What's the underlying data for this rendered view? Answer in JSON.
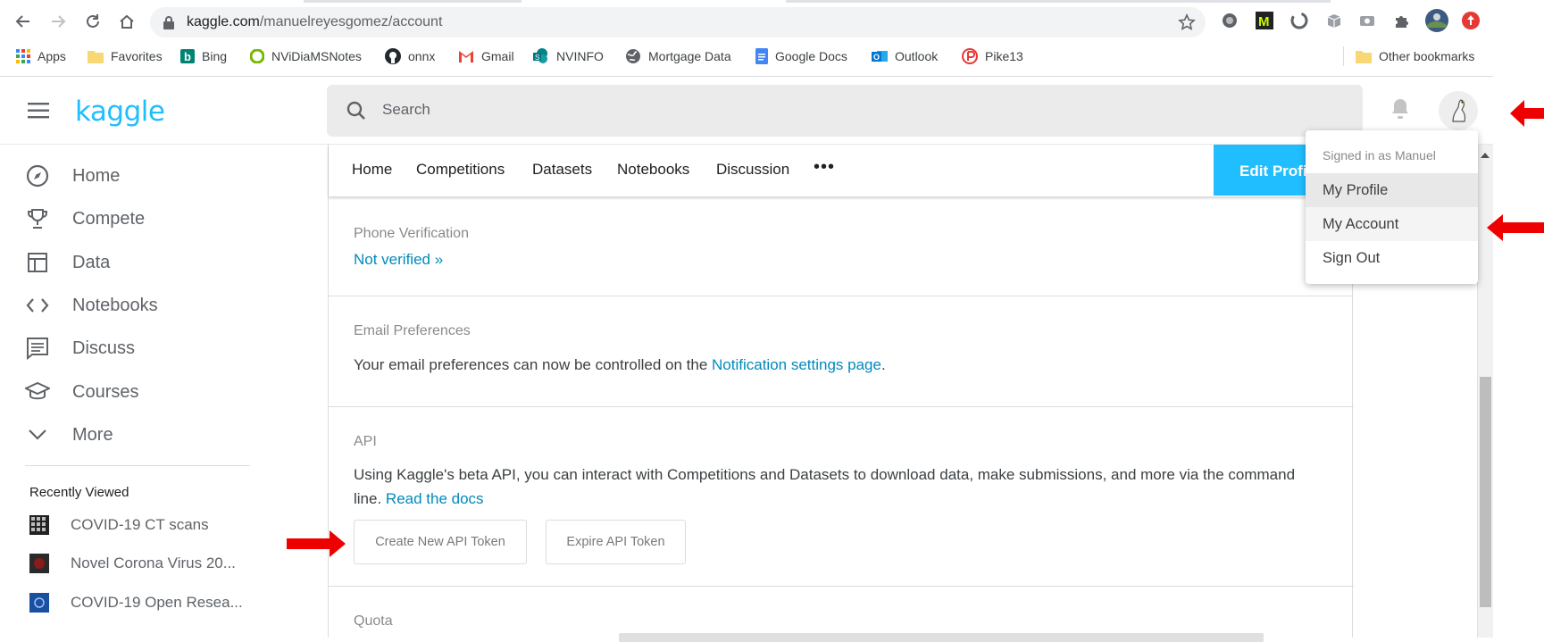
{
  "browser": {
    "url_host": "kaggle.com",
    "url_path": "/manuelreyesgomez/account",
    "nav_icons": [
      "back-icon",
      "forward-icon",
      "reload-icon",
      "home-icon",
      "lock-icon",
      "star-icon"
    ],
    "extensions": [
      "ext-circle-icon",
      "ext-m-icon",
      "ext-spinner-icon",
      "ext-box-icon",
      "ext-camera-icon",
      "puzzle-icon",
      "profile-avatar-icon",
      "ext-red-icon"
    ],
    "bookmarks": [
      {
        "label": "Apps",
        "icon": "apps-grid-icon",
        "color": "#4285f4"
      },
      {
        "label": "Favorites",
        "icon": "folder-icon",
        "color": "#f8d775"
      },
      {
        "label": "Bing",
        "icon": "bing-icon",
        "color": "#008373"
      },
      {
        "label": "NViDiaMSNotes",
        "icon": "nvidia-icon",
        "color": "#76b900"
      },
      {
        "label": "onnx",
        "icon": "github-icon",
        "color": "#24292e"
      },
      {
        "label": "Gmail",
        "icon": "gmail-icon",
        "color": "#ea4335"
      },
      {
        "label": "NVINFO",
        "icon": "sharepoint-icon",
        "color": "#038387"
      },
      {
        "label": "Mortgage Data",
        "icon": "globe-icon",
        "color": "#5f6368"
      },
      {
        "label": "Google Docs",
        "icon": "docs-icon",
        "color": "#4285f4"
      },
      {
        "label": "Outlook",
        "icon": "outlook-icon",
        "color": "#0078d4"
      },
      {
        "label": "Pike13",
        "icon": "pike13-icon",
        "color": "#e53935"
      }
    ],
    "other_bookmarks": "Other bookmarks"
  },
  "header": {
    "logo": "kaggle",
    "search_placeholder": "Search"
  },
  "sidebar": {
    "items": [
      {
        "label": "Home",
        "icon": "compass-icon"
      },
      {
        "label": "Compete",
        "icon": "trophy-icon"
      },
      {
        "label": "Data",
        "icon": "table-icon"
      },
      {
        "label": "Notebooks",
        "icon": "code-icon"
      },
      {
        "label": "Discuss",
        "icon": "comment-icon"
      },
      {
        "label": "Courses",
        "icon": "graduation-cap-icon"
      },
      {
        "label": "More",
        "icon": "chevron-down-icon"
      }
    ],
    "recently_viewed_title": "Recently Viewed",
    "recently_viewed": [
      {
        "label": "COVID-19 CT scans",
        "icon": "ct-scan-thumbnail"
      },
      {
        "label": "Novel Corona Virus 20...",
        "icon": "corona-thumbnail"
      },
      {
        "label": "COVID-19 Open Resea...",
        "icon": "cord19-thumbnail"
      }
    ]
  },
  "profile_tabs": {
    "items": [
      "Home",
      "Competitions",
      "Datasets",
      "Notebooks",
      "Discussion"
    ],
    "more": "•••",
    "edit_button": "Edit Profile"
  },
  "account": {
    "phone": {
      "label": "Phone Verification",
      "status": "Not verified »"
    },
    "email": {
      "label": "Email Preferences",
      "text": "Your email preferences can now be controlled on the ",
      "link": "Notification settings page",
      "suffix": "."
    },
    "api": {
      "label": "API",
      "text": "Using Kaggle's beta API, you can interact with Competitions and Datasets to download data, make submissions, and more via the command line. ",
      "link": "Read the docs",
      "create_button": "Create New API Token",
      "expire_button": "Expire API Token"
    },
    "quota": {
      "label": "Quota"
    }
  },
  "user_menu": {
    "signed_in": "Signed in as Manuel",
    "items": [
      "My Profile",
      "My Account",
      "Sign Out"
    ]
  },
  "colors": {
    "kaggle_blue": "#20beff",
    "link": "#008abc",
    "annotation_arrow": "#ee0000"
  }
}
